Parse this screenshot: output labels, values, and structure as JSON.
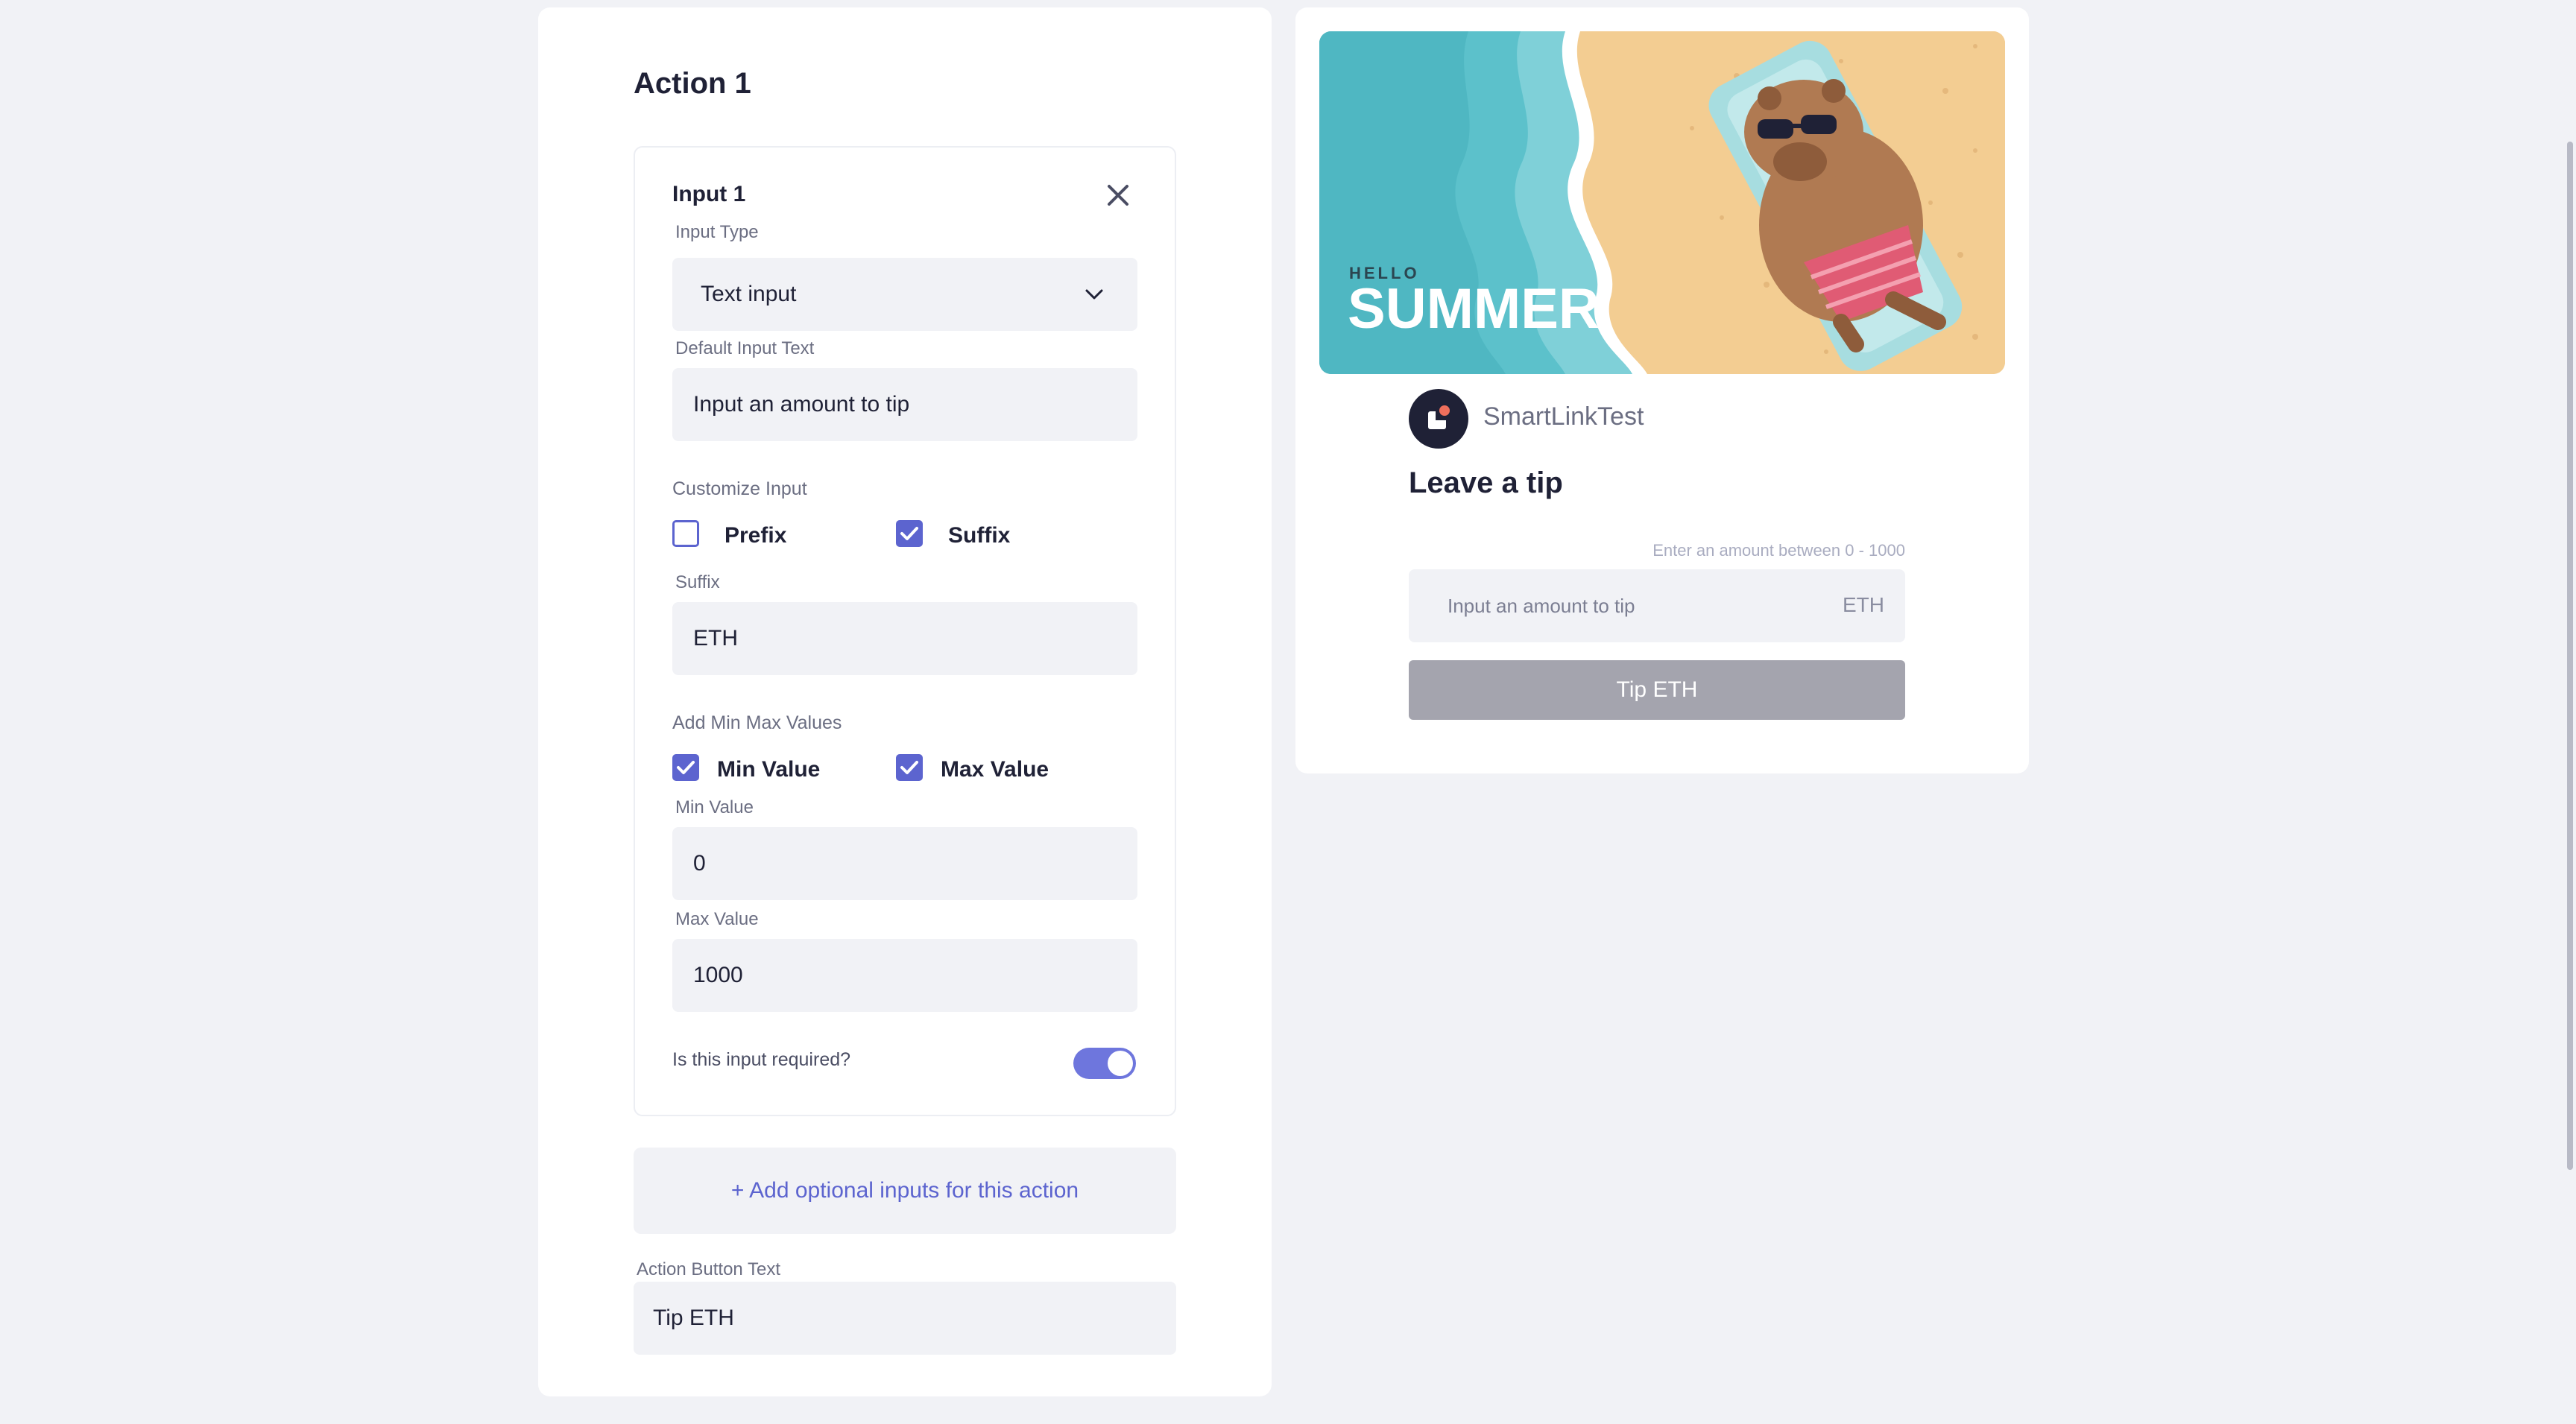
{
  "editor": {
    "action_title": "Action 1",
    "input_card": {
      "title": "Input 1",
      "input_type_label": "Input Type",
      "input_type_value": "Text input",
      "default_text_label": "Default Input Text",
      "default_text_value": "Input an amount to tip",
      "customize_label": "Customize Input",
      "prefix_label": "Prefix",
      "prefix_checked": false,
      "suffix_label": "Suffix",
      "suffix_checked": true,
      "suffix_field_label": "Suffix",
      "suffix_value": "ETH",
      "minmax_label": "Add Min Max Values",
      "min_check_label": "Min Value",
      "min_checked": true,
      "max_check_label": "Max Value",
      "max_checked": true,
      "min_field_label": "Min Value",
      "min_value": "0",
      "max_field_label": "Max Value",
      "max_value": "1000",
      "required_label": "Is this input required?",
      "required_on": true
    },
    "add_optional_label": "+ Add optional inputs for this action",
    "button_text_label": "Action Button Text",
    "button_text_value": "Tip ETH"
  },
  "preview": {
    "banner": {
      "small_text": "HELLO",
      "big_text": "SUMMER"
    },
    "profile_name": "SmartLinkTest",
    "title": "Leave a tip",
    "range_hint": "Enter an amount between 0 - 1000",
    "input_placeholder": "Input an amount to tip",
    "input_suffix": "ETH",
    "button_label": "Tip ETH"
  },
  "colors": {
    "accent": "#5c64cf",
    "toggle": "#6e76dd",
    "background": "#f1f2f6",
    "disabled_button": "#a4a4ae"
  },
  "icons": [
    "close-icon",
    "chevron-down-icon",
    "checkmark-icon",
    "profile-logo-icon"
  ]
}
